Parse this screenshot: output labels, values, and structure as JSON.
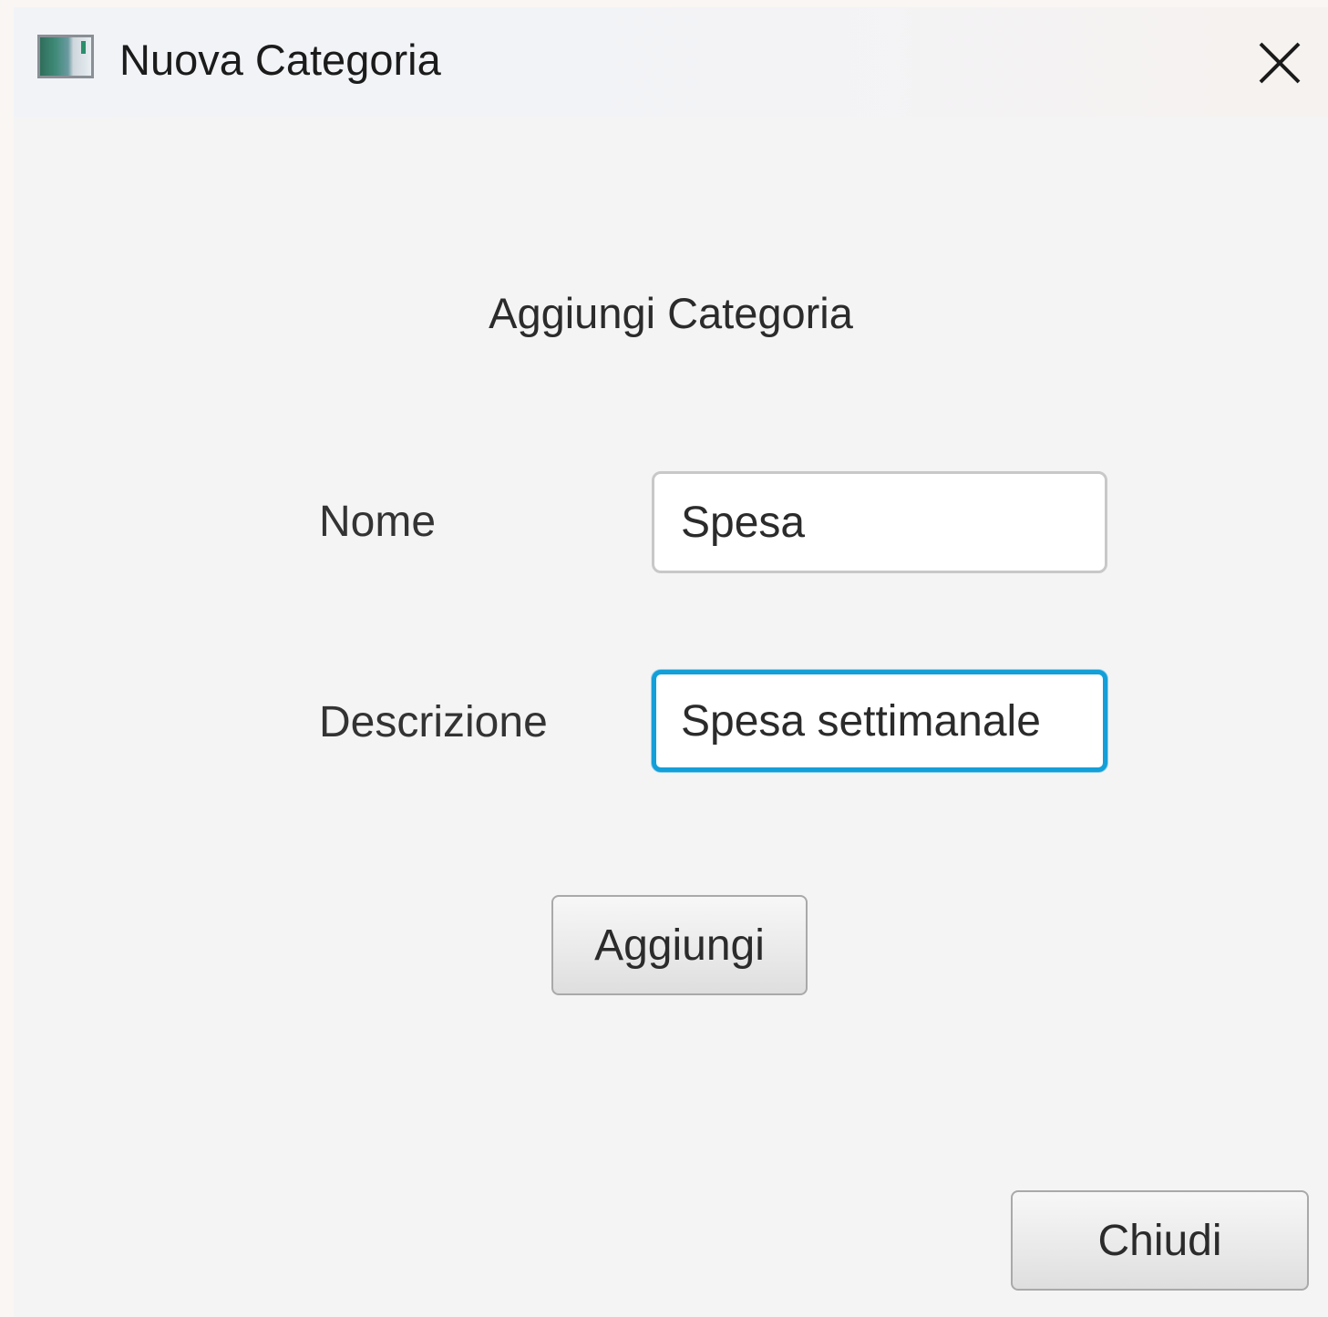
{
  "window": {
    "title": "Nuova Categoria",
    "icon": "app-window-icon",
    "close_icon": "close-icon"
  },
  "form": {
    "heading": "Aggiungi Categoria",
    "fields": [
      {
        "label": "Nome",
        "value": "Spesa",
        "focused": false
      },
      {
        "label": "Descrizione",
        "value": "Spesa settimanale",
        "focused": true
      }
    ],
    "add_button": "Aggiungi"
  },
  "footer": {
    "close_button": "Chiudi"
  },
  "colors": {
    "focus_border": "#139fd8",
    "background": "#f4f4f4"
  }
}
